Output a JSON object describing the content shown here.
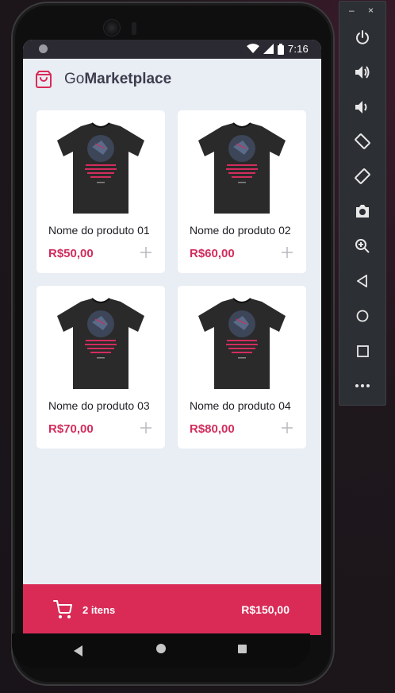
{
  "status_bar": {
    "time": "7:16"
  },
  "app": {
    "title_prefix": "Go",
    "title_bold": "Marketplace"
  },
  "products": [
    {
      "name": "Nome do produto 01",
      "price": "R$50,00"
    },
    {
      "name": "Nome do produto 02",
      "price": "R$60,00"
    },
    {
      "name": "Nome do produto 03",
      "price": "R$70,00"
    },
    {
      "name": "Nome do produto 04",
      "price": "R$80,00"
    }
  ],
  "cart": {
    "count_label": "2 itens",
    "total": "R$150,00"
  },
  "emulator_toolbar": {
    "top": {
      "minimize": "–",
      "close": "×"
    },
    "buttons": [
      "power-icon",
      "volume-up-icon",
      "volume-down-icon",
      "rotate-left-icon",
      "rotate-right-icon",
      "camera-icon",
      "zoom-icon",
      "back-icon",
      "home-icon",
      "overview-icon",
      "more-icon"
    ]
  },
  "colors": {
    "accent": "#d92b56",
    "price": "#d22d5d",
    "background": "#e9edf4",
    "status_bar": "#2b2931"
  }
}
